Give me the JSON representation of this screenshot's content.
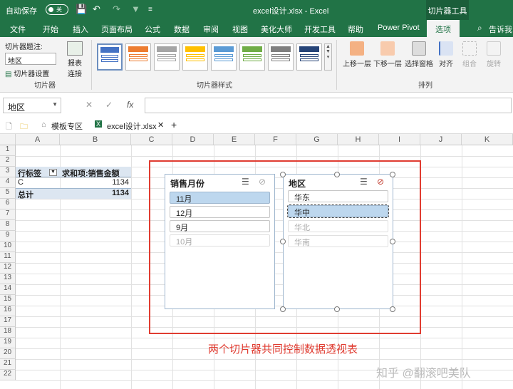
{
  "titlebar": {
    "autosave_label": "自动保存",
    "autosave_state": "关",
    "document_title": "excel设计.xlsx  -  Excel",
    "context_tab_group": "切片器工具"
  },
  "ribbon_tabs": [
    "文件",
    "开始",
    "插入",
    "页面布局",
    "公式",
    "数据",
    "审阅",
    "视图",
    "美化大师",
    "开发工具",
    "帮助",
    "Power Pivot",
    "选项",
    "告诉我"
  ],
  "ribbon": {
    "slicer_group": {
      "caption_label": "切片器题注:",
      "caption_value": "地区",
      "settings_label": "切片器设置",
      "report_connections_label_1": "报表",
      "report_connections_label_2": "连接",
      "group_label": "切片器"
    },
    "styles_group": {
      "group_label": "切片器样式"
    },
    "arrange_group": {
      "bring_forward": "上移一层",
      "send_backward": "下移一层",
      "selection_pane": "选择窗格",
      "align": "对齐",
      "group": "组合",
      "rotate": "旋转",
      "group_label": "排列"
    }
  },
  "formula_bar": {
    "name_box": "地区",
    "cancel_icon": "✕",
    "enter_icon": "✓",
    "fx_label": "fx",
    "formula": ""
  },
  "file_tabs": {
    "template_tab": "模板专区",
    "workbook_tab": "excel设计.xlsx",
    "add": "+"
  },
  "sheet": {
    "columns": [
      "A",
      "B",
      "C",
      "D",
      "E",
      "F",
      "G",
      "H",
      "I",
      "J",
      "K"
    ],
    "rows": [
      "1",
      "2",
      "3",
      "4",
      "5",
      "6",
      "7",
      "8",
      "9",
      "10",
      "11",
      "12",
      "13",
      "14",
      "15",
      "16",
      "17",
      "18",
      "19",
      "20",
      "21",
      "22"
    ],
    "pivot": {
      "row_label_header": "行标签",
      "value_header": "求和项:销售金额",
      "rows": [
        {
          "label": "C",
          "value": "1134"
        }
      ],
      "total_label": "总计",
      "total_value": "1134"
    }
  },
  "slicers": [
    {
      "title": "销售月份",
      "items": [
        {
          "label": "11月",
          "state": "selected"
        },
        {
          "label": "12月",
          "state": "normal"
        },
        {
          "label": "9月",
          "state": "normal"
        },
        {
          "label": "10月",
          "state": "nodata"
        }
      ]
    },
    {
      "title": "地区",
      "items": [
        {
          "label": "华东",
          "state": "normal"
        },
        {
          "label": "华中",
          "state": "selected"
        },
        {
          "label": "华北",
          "state": "nodata"
        },
        {
          "label": "华南",
          "state": "nodata"
        }
      ]
    }
  ],
  "annotation": "两个切片器共同控制数据透视表",
  "watermark": "知乎 @翻滚吧美队",
  "colors": {
    "excel_green": "#217346",
    "slicer_selected": "#bdd7ee",
    "annotation_red": "#e03c31"
  }
}
